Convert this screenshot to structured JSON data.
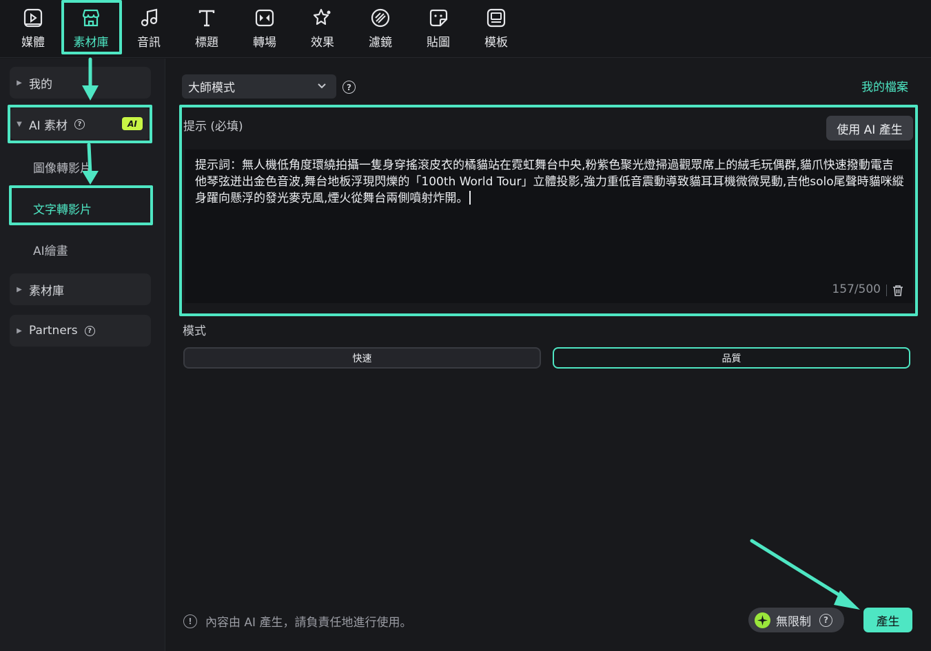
{
  "toolbar": {
    "tabs": [
      {
        "label": "媒體",
        "icon": "media-icon"
      },
      {
        "label": "素材庫",
        "icon": "store-icon"
      },
      {
        "label": "音訊",
        "icon": "music-note-icon"
      },
      {
        "label": "標題",
        "icon": "title-t-icon"
      },
      {
        "label": "轉場",
        "icon": "transition-icon"
      },
      {
        "label": "效果",
        "icon": "effects-star-icon"
      },
      {
        "label": "濾鏡",
        "icon": "filter-icon"
      },
      {
        "label": "貼圖",
        "icon": "sticker-icon"
      },
      {
        "label": "模板",
        "icon": "template-icon"
      }
    ],
    "active_tab": "素材庫"
  },
  "sidebar": {
    "my": "我的",
    "ai_assets": "AI 素材",
    "ai_badge": "AI",
    "items": [
      "圖像轉影片",
      "文字轉影片",
      "AI繪畫"
    ],
    "active_item": "文字轉影片",
    "library": "素材庫",
    "partners": "Partners"
  },
  "main": {
    "mode_select": "大師模式",
    "my_files": "我的檔案",
    "prompt_label": "提示 (必填)",
    "ai_generate_button": "使用 AI 產生",
    "prompt_text": "提示詞：無人機低角度環繞拍攝一隻身穿搖滾皮衣的橘貓站在霓虹舞台中央,粉紫色聚光燈掃過觀眾席上的絨毛玩偶群,貓爪快速撥動電吉他琴弦迸出金色音波,舞台地板浮現閃爍的「100th World Tour」立體投影,強力重低音震動導致貓耳耳機微微晃動,吉他solo尾聲時貓咪縱身躍向懸浮的發光麥克風,煙火從舞台兩側噴射炸開。",
    "char_count": "157/500",
    "mode_label": "模式",
    "mode_fast": "快速",
    "mode_quality": "品質",
    "selected_mode": "品質",
    "disclaimer": "內容由 AI 產生，請負責任地進行使用。",
    "credits_label": "無限制",
    "generate_button": "產生"
  },
  "colors": {
    "accent": "#4ee6c3",
    "ai_badge": "#c8f545",
    "background": "#18191c"
  }
}
